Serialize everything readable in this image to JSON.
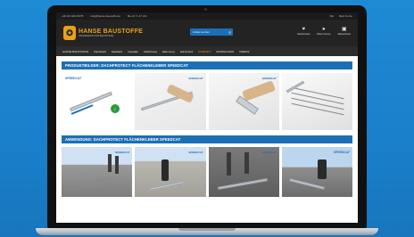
{
  "topbar": {
    "left": [
      "+49 40 1234 5678",
      "info@hanse-baustoffe.de",
      "Mo–Fr 7–17 Uhr"
    ],
    "right": [
      "DE",
      "Mein Konto"
    ]
  },
  "header": {
    "logo_name": "HANSE BAUSTOFFE",
    "logo_sub": "ONLINESHOP FÜR BAUSTOFFE",
    "search_placeholder": "Artikel suchen",
    "icons": [
      {
        "icon": "heart-icon",
        "label": "Merkzettel"
      },
      {
        "icon": "user-icon",
        "label": "Mein Konto"
      },
      {
        "icon": "cart-icon",
        "label": "Warenkorb"
      }
    ]
  },
  "nav": {
    "items": [
      "HANSE BAUSTOFFE",
      "Flachdach",
      "Steildach",
      "Fassade",
      "Abdichtung",
      "Dämmung",
      "Holzschutz",
      "KONTAKT",
      "DOWNLOADS",
      "VIDEOS"
    ]
  },
  "sections": [
    {
      "title": "PRODUKTBILDER: DACHPROTECT FLÄCHENKLEBER SPEEDCAT"
    },
    {
      "title": "ANWENDUNG: DACHPROTECT FLÄCHENKLEBER SPEEDCAT"
    }
  ],
  "badge_text": "SPEEDCAT",
  "colors": {
    "brand_blue": "#1c6fb5",
    "brand_orange": "#e8a21a",
    "header_dark": "#232323",
    "background_blue": "#1a7fca"
  }
}
